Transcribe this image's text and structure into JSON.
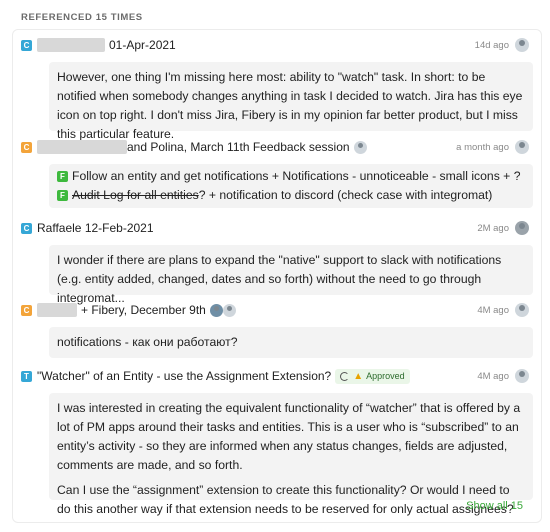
{
  "heading": "REFERENCED 15 TIMES",
  "references": [
    {
      "badge": "C",
      "title": "01-Apr-2021",
      "ago": "14d ago",
      "quote": "However, one thing I'm missing here most: ability to \"watch\" task. In short: to be notified when somebody changes anything in task I decided to watch. Jira has this eye icon on top right. I don't miss Jira, Fibery is in my opinion far better product, but I miss this particular feature."
    },
    {
      "badge": "C",
      "title": "and Polina, March 11th Feedback session",
      "ago": "a month ago",
      "line1_chip": "F",
      "line1": "Follow an entity and get notifications  + Notifications - unnoticeable - small icons + ?",
      "line2_chip": "F",
      "line2_strike": "Audit Log for all entities",
      "line2_rest": "?  + notification to discord (check case with integromat)"
    },
    {
      "badge": "C",
      "title": "Raffaele 12-Feb-2021",
      "ago": "2M ago",
      "quote": " I wonder if there are plans to expand the \"native\" support to slack with notifications (e.g. entity added, changed, dates and so forth) without the need to go through integromat..."
    },
    {
      "badge": "C",
      "title": "+ Fibery, December 9th",
      "ago": "4M ago",
      "quote": "notifications - как они работают?"
    },
    {
      "badge": "T",
      "title": "\"Watcher\" of an Entity - use the Assignment Extension?",
      "status": "Approved",
      "ago": "4M ago",
      "quote_p1": "I was interested in creating the equivalent functionality of “watcher” that is offered by a lot of PM apps around their tasks and entities. This is a user who is “subscribed” to an entity’s activity - so they are informed when any status changes, fields are adjusted, comments are made, and so forth.",
      "quote_p2": "Can I use the “assignment” extension to create this functionality? Or would I need to do this another way if that extension needs to be reserved for only actual assignees?"
    }
  ],
  "show_all": "Show all 15",
  "colors": {
    "badge_c": "#35a7d6",
    "badge_orange": "#f3a43a",
    "feature_chip": "#3eb93e",
    "link": "#3aa83a"
  }
}
